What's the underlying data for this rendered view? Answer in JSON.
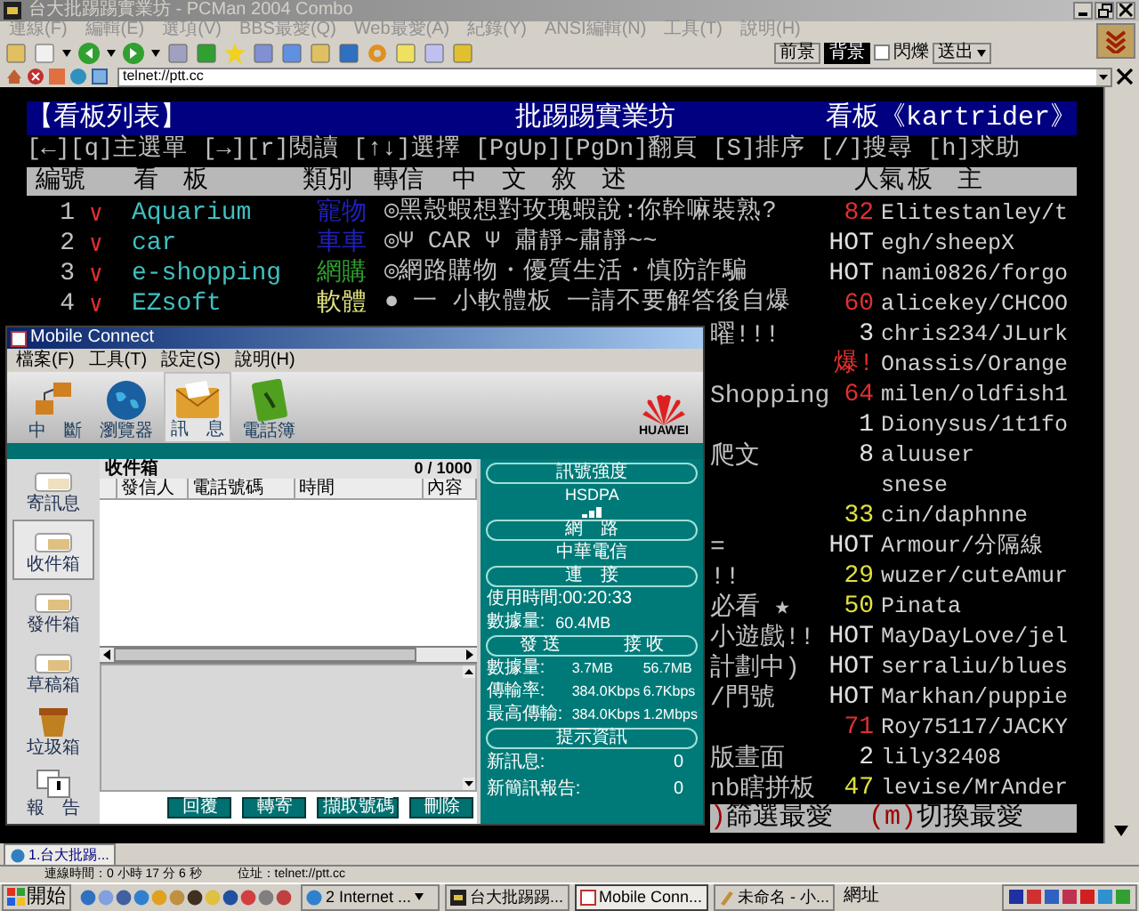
{
  "window": {
    "title": "台大批踢踢實業坊 - PCMan 2004 Combo"
  },
  "menu": [
    "連線(F)",
    "編輯(E)",
    "選項(V)",
    "BBS最愛(Q)",
    "Web最愛(A)",
    "紀錄(Y)",
    "ANSI編輯(N)",
    "工具(T)",
    "說明(H)"
  ],
  "color_buttons": [
    {
      "label": "前景",
      "selected": false
    },
    {
      "label": "背景",
      "selected": true
    }
  ],
  "blink": {
    "label": "閃爍",
    "checked": false
  },
  "send_button": "送出",
  "address": {
    "value": "telnet://ptt.cc"
  },
  "terminal": {
    "header": {
      "left": "【看板列表】",
      "center": "批踢踢實業坊",
      "right": "看板《kartrider》"
    },
    "help": "[←][q]主選單 [→][r]閱讀 [↑↓]選擇 [PgUp][PgDn]翻頁 [S]排序 [/]搜尋 [h]求助",
    "columns": [
      "編號",
      "看　板",
      "類別",
      "轉信",
      "中　文　敘　述",
      "人氣",
      "板　主"
    ],
    "rows": [
      {
        "kind": "full",
        "number": "1",
        "mark": "∨",
        "board": "Aquarium",
        "category": {
          "text": "寵物",
          "color": "#2020c0"
        },
        "description": "◎黑殼蝦想對玫瑰蝦說:你幹嘛裝熟?",
        "popularity": {
          "text": "82",
          "color": "#e03030"
        },
        "moderators": "Elitestanley/t"
      },
      {
        "kind": "full",
        "number": "2",
        "mark": "∨",
        "board": "car",
        "category": {
          "text": "車車",
          "color": "#2020c0"
        },
        "description": "◎Ψ CAR Ψ 肅靜~肅靜~~",
        "popularity": {
          "text": "HOT",
          "color": "#e0e0e0"
        },
        "moderators": "egh/sheepX"
      },
      {
        "kind": "full",
        "number": "3",
        "mark": "∨",
        "board": "e-shopping",
        "category": {
          "text": "網購",
          "color": "#30a030"
        },
        "description": "◎網路購物・優質生活・慎防詐騙",
        "popularity": {
          "text": "HOT",
          "color": "#e0e0e0"
        },
        "moderators": "nami0826/forgo"
      },
      {
        "kind": "full",
        "number": "4",
        "mark": "∨",
        "board": "EZsoft",
        "category": {
          "text": "軟體",
          "color": "#e0e080"
        },
        "description": "● 一 小軟體板 一請不要解答後自爆",
        "popularity": {
          "text": "60",
          "color": "#e03030"
        },
        "moderators": "alicekey/CHCOO"
      },
      {
        "kind": "covered",
        "tail": "曜!!!",
        "popularity": {
          "text": "3",
          "color": "#e0e0e0"
        },
        "moderators": "chris234/JLurk"
      },
      {
        "kind": "covered",
        "popularity": {
          "text": "爆!",
          "color": "#e03030"
        },
        "moderators": "Onassis/Orange"
      },
      {
        "kind": "covered",
        "tail": "Shopping",
        "popularity": {
          "text": "64",
          "color": "#e03030"
        },
        "moderators": "milen/oldfish1"
      },
      {
        "kind": "covered",
        "popularity": {
          "text": "1",
          "color": "#e0e0e0"
        },
        "moderators": "Dionysus/1t1fo"
      },
      {
        "kind": "covered",
        "tail": "爬文",
        "popularity": {
          "text": "8",
          "color": "#e0e0e0"
        },
        "moderators": "aluuser"
      },
      {
        "kind": "covered",
        "moderators": "snese"
      },
      {
        "kind": "covered",
        "popularity": {
          "text": "33",
          "color": "#e0e040"
        },
        "moderators": "cin/daphnne"
      },
      {
        "kind": "covered",
        "tail": "=",
        "popularity": {
          "text": "HOT",
          "color": "#e0e0e0"
        },
        "moderators": "Armour/分隔線"
      },
      {
        "kind": "covered",
        "tail": "!!",
        "popularity": {
          "text": "29",
          "color": "#e0e040"
        },
        "moderators": "wuzer/cuteAmur"
      },
      {
        "kind": "covered",
        "tail": "必看 ★",
        "popularity": {
          "text": "50",
          "color": "#e0e040"
        },
        "moderators": "Pinata"
      },
      {
        "kind": "covered",
        "tail": "小遊戲!!",
        "popularity": {
          "text": "HOT",
          "color": "#e0e0e0"
        },
        "moderators": "MayDayLove/jel"
      },
      {
        "kind": "covered",
        "tail": "計劃中)",
        "popularity": {
          "text": "HOT",
          "color": "#e0e0e0"
        },
        "moderators": "serraliu/blues"
      },
      {
        "kind": "covered",
        "tail": "/門號",
        "popularity": {
          "text": "HOT",
          "color": "#e0e0e0"
        },
        "moderators": "Markhan/puppie"
      },
      {
        "kind": "covered",
        "popularity": {
          "text": "71",
          "color": "#e03030"
        },
        "moderators": "Roy75117/JACKY"
      },
      {
        "kind": "covered",
        "tail": "版畫面",
        "popularity": {
          "text": "2",
          "color": "#e0e0e0"
        },
        "moderators": "lily32408"
      },
      {
        "kind": "covered",
        "tail": "nb瞎拼板",
        "popularity": {
          "text": "47",
          "color": "#e0e040"
        },
        "moderators": "levise/MrAnder"
      }
    ],
    "footer": [
      {
        "kind": "key",
        "text": ")"
      },
      {
        "kind": "plain",
        "text": "篩選最愛"
      },
      {
        "kind": "key",
        "text": "(m)"
      },
      {
        "kind": "plain",
        "text": "切換最愛"
      }
    ]
  },
  "mobile_connect": {
    "title": "Mobile Connect",
    "menu": [
      "檔案(F)",
      "工具(T)",
      "設定(S)",
      "說明(H)"
    ],
    "tools": [
      {
        "kind": "disconnect",
        "label": "中　斷",
        "selected": false
      },
      {
        "kind": "browser",
        "label": "瀏覽器",
        "selected": false
      },
      {
        "kind": "message",
        "label": "訊　息",
        "selected": true
      },
      {
        "kind": "phonebook",
        "label": "電話簿",
        "selected": false
      }
    ],
    "logo": "HUAWEI",
    "folders": [
      {
        "kind": "compose",
        "label": "寄訊息",
        "selected": false
      },
      {
        "kind": "inbox",
        "label": "收件箱",
        "selected": true
      },
      {
        "kind": "outbox",
        "label": "發件箱",
        "selected": false
      },
      {
        "kind": "drafts",
        "label": "草稿箱",
        "selected": false
      },
      {
        "kind": "trash",
        "label": "垃圾箱",
        "selected": false
      },
      {
        "kind": "report",
        "label": "報　告",
        "selected": false
      }
    ],
    "list": {
      "title": "收件箱",
      "count": "0 / 1000",
      "columns": [
        "發信人",
        "電話號碼",
        "時間",
        "內容"
      ]
    },
    "buttons": [
      "回覆",
      "轉寄",
      "擷取號碼",
      "刪除"
    ],
    "status": {
      "signal_heading": "訊號強度",
      "network_type": "HSDPA",
      "network_heading": "網　路",
      "operator": "中華電信",
      "connect_button": "連　接",
      "usage_time": "使用時間:00:20:33",
      "data_label": "數據量:",
      "data_total": "60.4MB",
      "transfer_headings": [
        "發 送",
        "接 收"
      ],
      "stats": [
        {
          "label": "數據量:",
          "sent": "3.7MB",
          "received": "56.7MB"
        },
        {
          "label": "傳輸率:",
          "sent": "384.0Kbps",
          "received": "6.7Kbps"
        },
        {
          "label": "最高傳輸:",
          "sent": "384.0Kbps",
          "received": "1.2Mbps"
        }
      ],
      "info_heading": "提示資訊",
      "info": [
        {
          "label": "新訊息:",
          "value": "0"
        },
        {
          "label": "新簡訊報告:",
          "value": "0"
        }
      ]
    }
  },
  "tab": {
    "label": "1.台大批踢...",
    "selected": true
  },
  "status_bar": {
    "time": "連線時間：0 小時 17 分 6 秒",
    "address": "位址：telnet://ptt.cc"
  },
  "taskbar": {
    "start": "開始",
    "tasks": [
      {
        "kind": "group",
        "label": "2 Internet ...",
        "selected": false
      },
      {
        "kind": "terminal",
        "label": "台大批踢踢...",
        "selected": false
      },
      {
        "kind": "mobile",
        "label": "Mobile Conn...",
        "selected": true
      },
      {
        "kind": "paint",
        "label": "未命名 - 小...",
        "selected": false
      }
    ],
    "address_label": "網址"
  }
}
